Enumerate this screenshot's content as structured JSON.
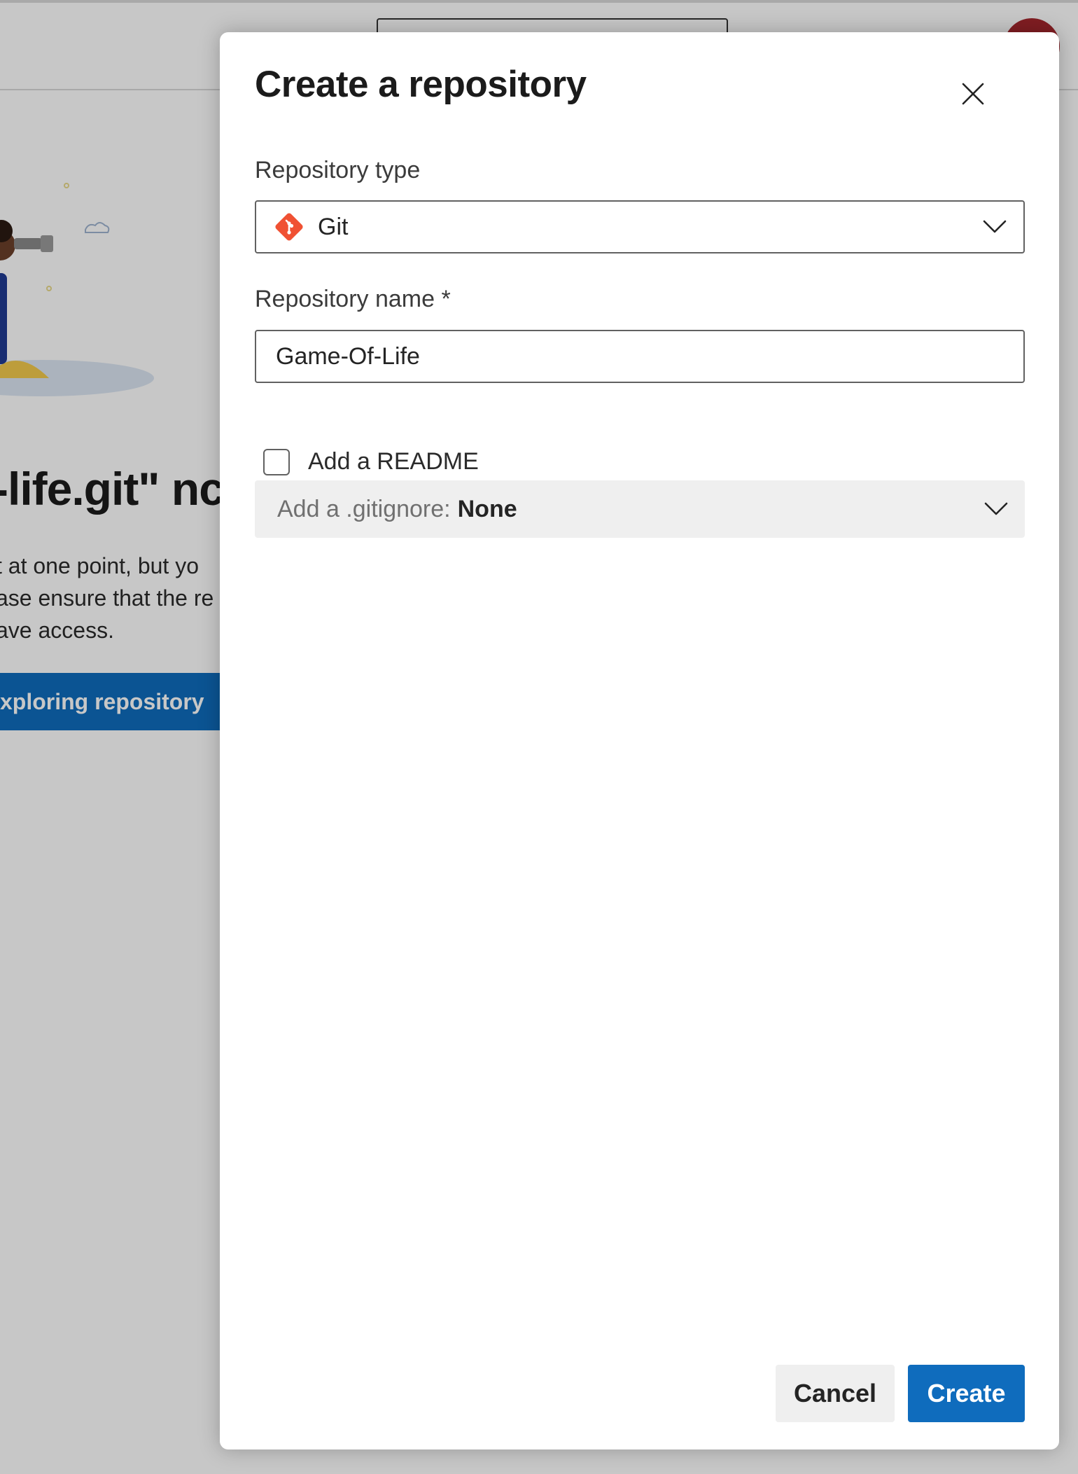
{
  "background": {
    "title_fragment": "-life.git\" nc",
    "body_lines": [
      "t at one point, but yo",
      "ase ensure that the re",
      "ave access."
    ],
    "button_label": "xploring repository"
  },
  "dialog": {
    "title": "Create a repository",
    "repo_type_label": "Repository type",
    "repo_type_value": "Git",
    "repo_name_label": "Repository name *",
    "repo_name_value": "Game-Of-Life",
    "readme_label": "Add a README",
    "readme_checked": false,
    "gitignore_prefix": "Add a .gitignore:",
    "gitignore_value": "None",
    "cancel_label": "Cancel",
    "create_label": "Create"
  },
  "colors": {
    "accent": "#0f6cbd",
    "git_brand": "#f05133",
    "avatar": "#a4262c"
  },
  "icons": {
    "close": "close-icon",
    "chevron": "chevron-down-icon",
    "git": "git-logo-icon"
  }
}
